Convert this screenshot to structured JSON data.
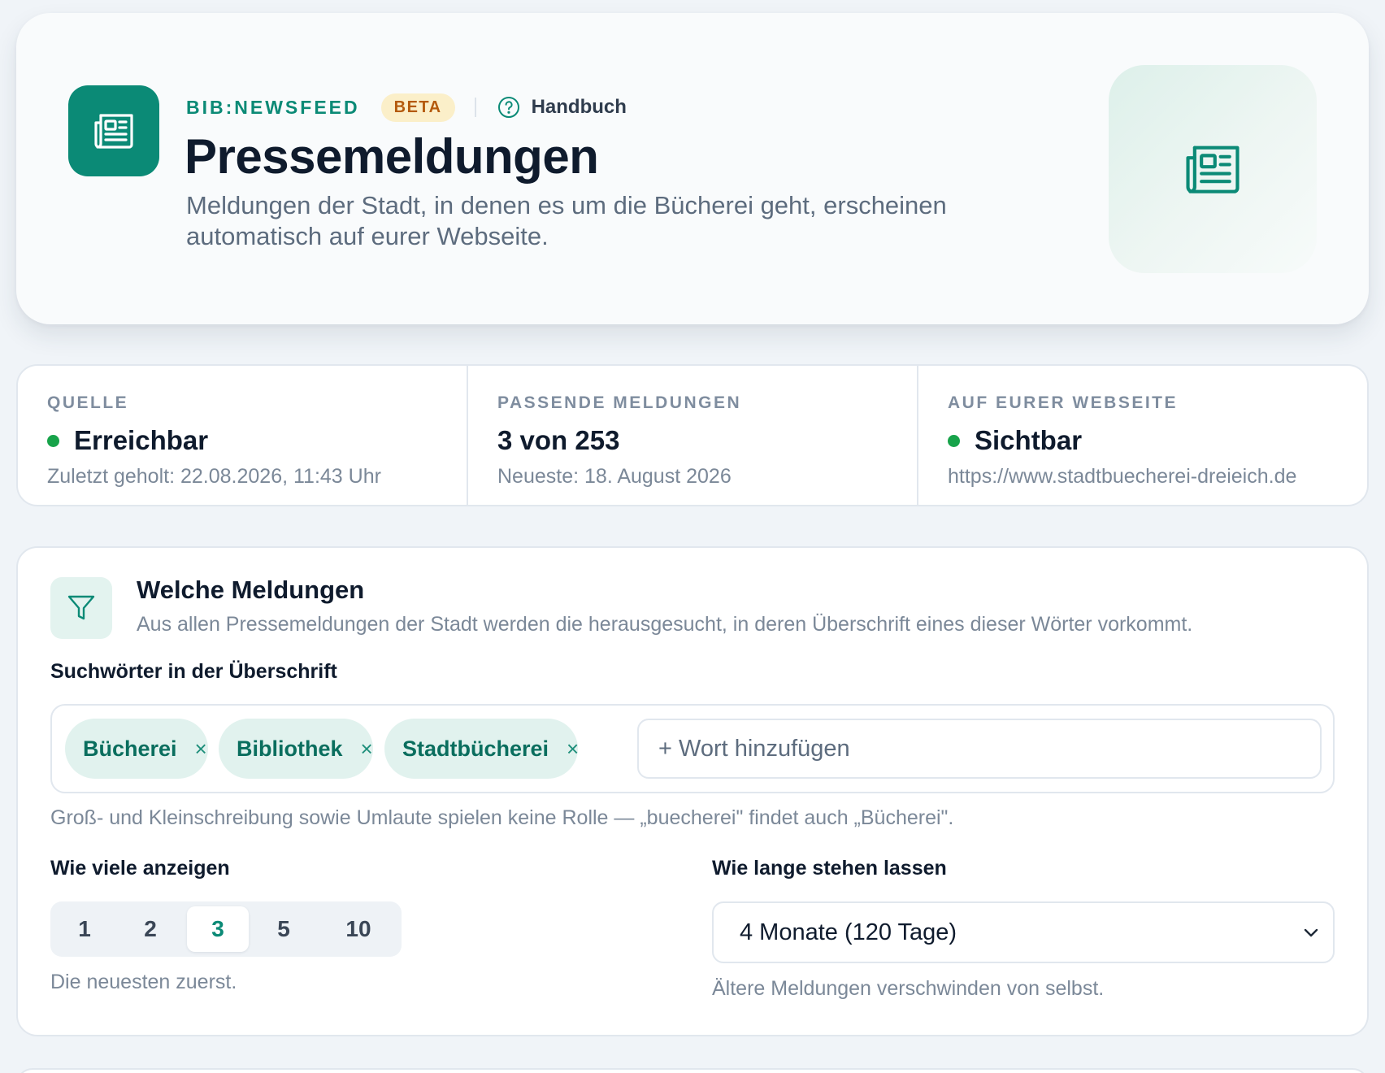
{
  "hero": {
    "brand": "BIB:NEWSFEED",
    "badge": "BETA",
    "help_label": "Handbuch",
    "help_icon": "question-circle-icon",
    "title": "Pressemeldungen",
    "subtitle": "Meldungen der Stadt, in denen es um die Bücherei geht, erscheinen automatisch auf eurer Webseite.",
    "logo_icon": "newspaper-icon",
    "art_icon": "newspaper-icon"
  },
  "stats": [
    {
      "label": "QUELLE",
      "value": "Erreichbar",
      "status": "ok",
      "sub": "Zuletzt geholt: 22.08.2026, 11:43 Uhr"
    },
    {
      "label": "PASSENDE MELDUNGEN",
      "value": "3 von 253",
      "sub": "Neueste: 18. August 2026"
    },
    {
      "label": "AUF EURER WEBSEITE",
      "value": "Sichtbar",
      "status": "ok",
      "sub": "https://www.stadtbuecherei-dreieich.de"
    }
  ],
  "filter": {
    "title": "Welche Meldungen",
    "description": "Aus allen Pressemeldungen der Stadt werden die herausgesucht, in deren Überschrift eines dieser Wörter vorkommt.",
    "icon": "filter-icon",
    "keywords_label": "Suchwörter in der Überschrift",
    "keywords": [
      "Bücherei",
      "Bibliothek",
      "Stadtbücherei"
    ],
    "remove_glyph": "×",
    "add_placeholder": "+ Wort hinzufügen",
    "keywords_hint": "Groß- und Kleinschreibung sowie Umlaute spielen keine Rolle — „buecherei\" findet auch „Bücherei\".",
    "count_label": "Wie viele anzeigen",
    "count_options": [
      "1",
      "2",
      "3",
      "5",
      "10"
    ],
    "count_selected": "3",
    "count_hint": "Die neuesten zuerst.",
    "duration_label": "Wie lange stehen lassen",
    "duration_value": "4 Monate (120 Tage)",
    "duration_hint": "Ältere Meldungen verschwinden von selbst."
  },
  "colors": {
    "accent": "#0b8a76",
    "status_ok": "#17a34a",
    "beta_bg": "#fbefc9",
    "beta_text": "#b45a0c"
  }
}
